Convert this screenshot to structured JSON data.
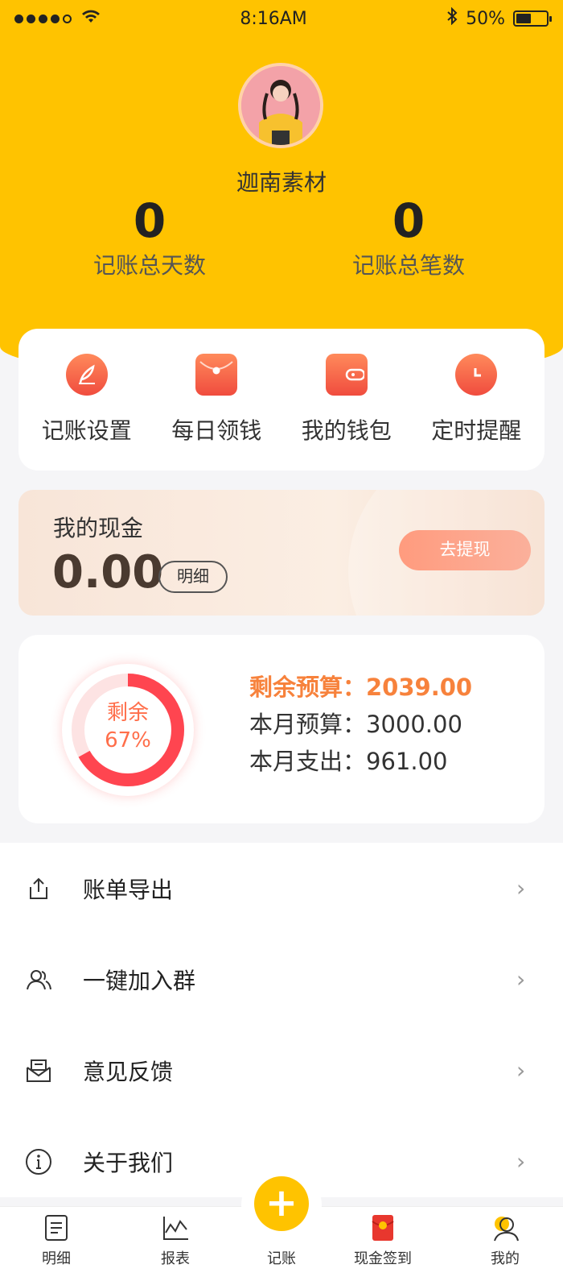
{
  "status": {
    "time": "8:16AM",
    "battery": "50%"
  },
  "profile": {
    "name": "迦南素材"
  },
  "stats": [
    {
      "value": "0",
      "label": "记账总天数"
    },
    {
      "value": "0",
      "label": "记账总笔数"
    }
  ],
  "quick": [
    {
      "label": "记账设置",
      "icon": "feather-icon"
    },
    {
      "label": "每日领钱",
      "icon": "red-envelope-icon"
    },
    {
      "label": "我的钱包",
      "icon": "wallet-icon"
    },
    {
      "label": "定时提醒",
      "icon": "alarm-clock-icon"
    }
  ],
  "cash": {
    "title": "我的现金",
    "amount": "0.00",
    "detail": "明细",
    "withdraw": "去提现"
  },
  "budget": {
    "ring_top": "剩余",
    "ring_bottom": "67%",
    "remaining_fraction": 0.67,
    "remaining": "剩余预算：2039.00",
    "monthly": "本月预算：3000.00",
    "spent": "本月支出：961.00"
  },
  "menu": [
    {
      "label": "账单导出",
      "icon": "export-icon"
    },
    {
      "label": "一键加入群",
      "icon": "group-icon"
    },
    {
      "label": "意见反馈",
      "icon": "feedback-mail-icon"
    },
    {
      "label": "关于我们",
      "icon": "info-icon"
    }
  ],
  "tabs": [
    {
      "label": "明细"
    },
    {
      "label": "报表"
    },
    {
      "label": "记账"
    },
    {
      "label": "现金签到"
    },
    {
      "label": "我的"
    }
  ],
  "colors": {
    "brand_yellow": "#FFC300",
    "accent_orange": "#F7823C",
    "ring_red": "#FF4550"
  }
}
